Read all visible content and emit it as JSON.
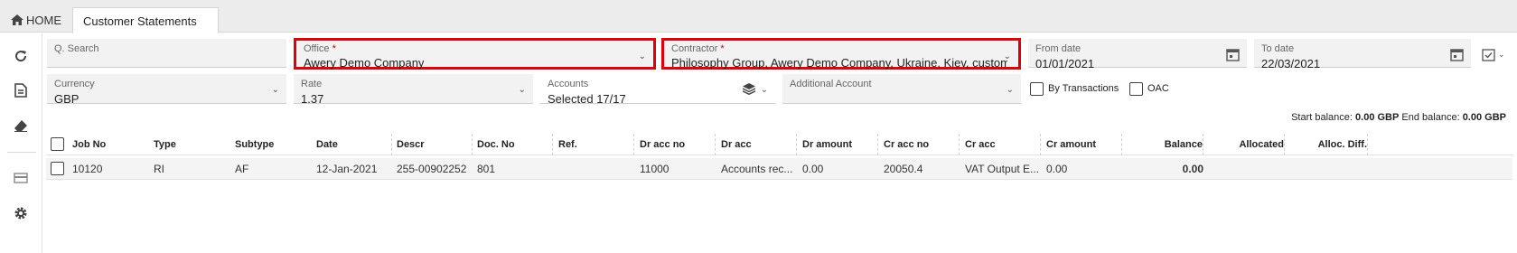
{
  "tabs": {
    "home_label": "HOME",
    "active_label": "Customer Statements"
  },
  "sidebar": {
    "items": [
      {
        "icon": "refresh-icon"
      },
      {
        "icon": "document-icon"
      },
      {
        "icon": "eraser-icon"
      },
      {
        "icon": "card-icon"
      },
      {
        "icon": "gear-icon"
      }
    ]
  },
  "filters": {
    "search": {
      "label": "Q. Search",
      "value": ""
    },
    "office": {
      "label": "Office",
      "required_mark": "*",
      "value": "Awery Demo Company"
    },
    "contractor": {
      "label": "Contractor",
      "required_mark": "*",
      "value": "Philosophy Group, Awery Demo Company, Ukraine, Kiev, customer,"
    },
    "from_date": {
      "label": "From date",
      "value": "01/01/2021"
    },
    "to_date": {
      "label": "To date",
      "value": "22/03/2021"
    },
    "currency": {
      "label": "Currency",
      "value": "GBP"
    },
    "rate": {
      "label": "Rate",
      "value": "1.37"
    },
    "accounts": {
      "label": "Accounts",
      "value": "Selected 17/17"
    },
    "additional_account": {
      "label": "Additional Account",
      "value": ""
    },
    "by_transactions": {
      "label": "By Transactions",
      "checked": false
    },
    "oac": {
      "label": "OAC",
      "checked": false
    }
  },
  "balances": {
    "start_label": "Start balance:",
    "start_value": "0.00 GBP",
    "end_label": "End balance:",
    "end_value": "0.00 GBP"
  },
  "table": {
    "columns": [
      "Job No",
      "Type",
      "Subtype",
      "Date",
      "Descr",
      "Doc. No",
      "Ref.",
      "Dr acc no",
      "Dr acc",
      "Dr amount",
      "Cr acc no",
      "Cr acc",
      "Cr amount",
      "Balance",
      "Allocated",
      "Alloc. Diff."
    ],
    "rows": [
      {
        "job_no": "10120",
        "type": "RI",
        "subtype": "AF",
        "date": "12-Jan-2021",
        "descr": "255-00902252",
        "doc_no": "801",
        "ref": "",
        "dr_acc_no": "11000",
        "dr_acc": "Accounts rec...",
        "dr_amount": "0.00",
        "cr_acc_no": "20050.4",
        "cr_acc": "VAT Output E...",
        "cr_amount": "0.00",
        "balance": "0.00",
        "allocated": "",
        "alloc_diff": ""
      }
    ]
  },
  "colors": {
    "highlight": "#e0000a",
    "balance_value": "#2a3ca8"
  }
}
